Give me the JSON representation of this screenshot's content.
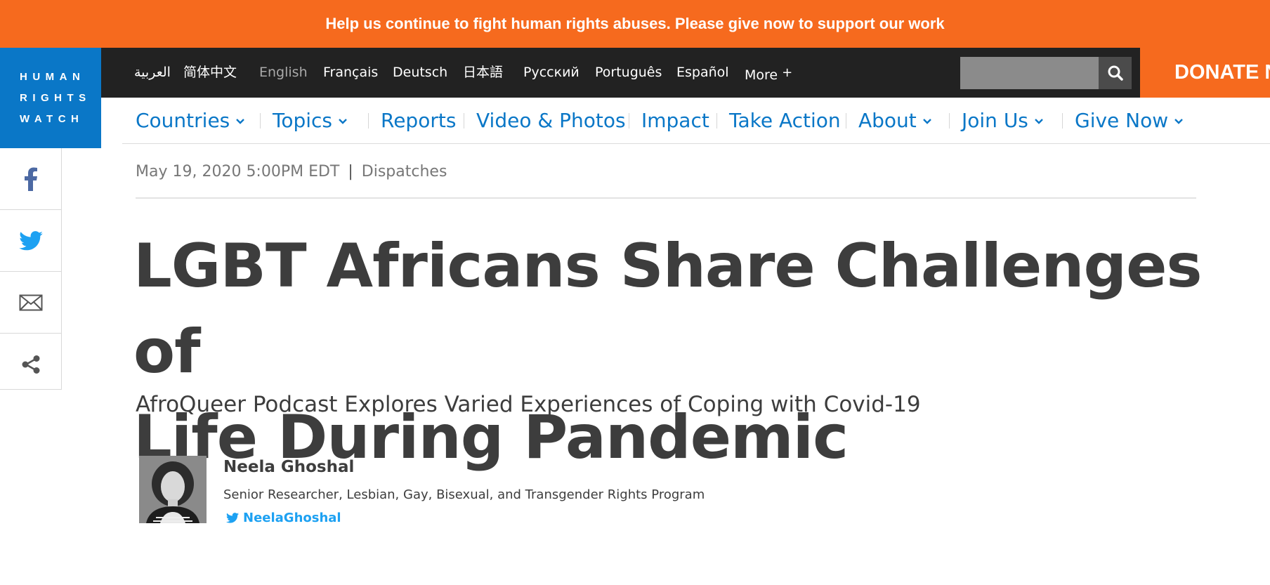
{
  "banner": {
    "text": "Help us continue to fight human rights abuses. Please give now to support our work"
  },
  "logo": {
    "line1": "HUMAN",
    "line2": "RIGHTS",
    "line3": "WATCH"
  },
  "languages": [
    {
      "label": "العربية"
    },
    {
      "label": "简体中文"
    },
    {
      "label": "English"
    },
    {
      "label": "Français"
    },
    {
      "label": "Deutsch"
    },
    {
      "label": "日本語"
    },
    {
      "label": "Русский"
    },
    {
      "label": "Português"
    },
    {
      "label": "Español"
    },
    {
      "label": "More"
    }
  ],
  "search": {
    "placeholder": ""
  },
  "donate": {
    "label": "DONATE NOW"
  },
  "nav": [
    {
      "label": "Countries"
    },
    {
      "label": "Topics"
    },
    {
      "label": "Reports"
    },
    {
      "label": "Video & Photos"
    },
    {
      "label": "Impact"
    },
    {
      "label": "Take Action"
    },
    {
      "label": "About"
    },
    {
      "label": "Join Us"
    },
    {
      "label": "Give Now"
    }
  ],
  "share": {
    "icons": [
      "facebook-icon",
      "twitter-icon",
      "email-icon",
      "share-icon"
    ]
  },
  "article": {
    "date": "May 19, 2020 5:00PM EDT",
    "separator": "|",
    "category": "Dispatches",
    "title_line1": "LGBT Africans Share Challenges of",
    "title_line2": "Life During Pandemic",
    "subtitle": "AfroQueer Podcast Explores Varied Experiences of Coping with Covid-19"
  },
  "author": {
    "name": "Neela Ghoshal",
    "role": "Senior Researcher, Lesbian, Gay, Bisexual, and Transgender Rights Program",
    "twitter": "NeelaGhoshal"
  },
  "colors": {
    "brand_orange": "#f66a1e",
    "brand_blue": "#0a77c7",
    "twitter_blue": "#1da1f2",
    "langbar_dark": "#222222"
  }
}
